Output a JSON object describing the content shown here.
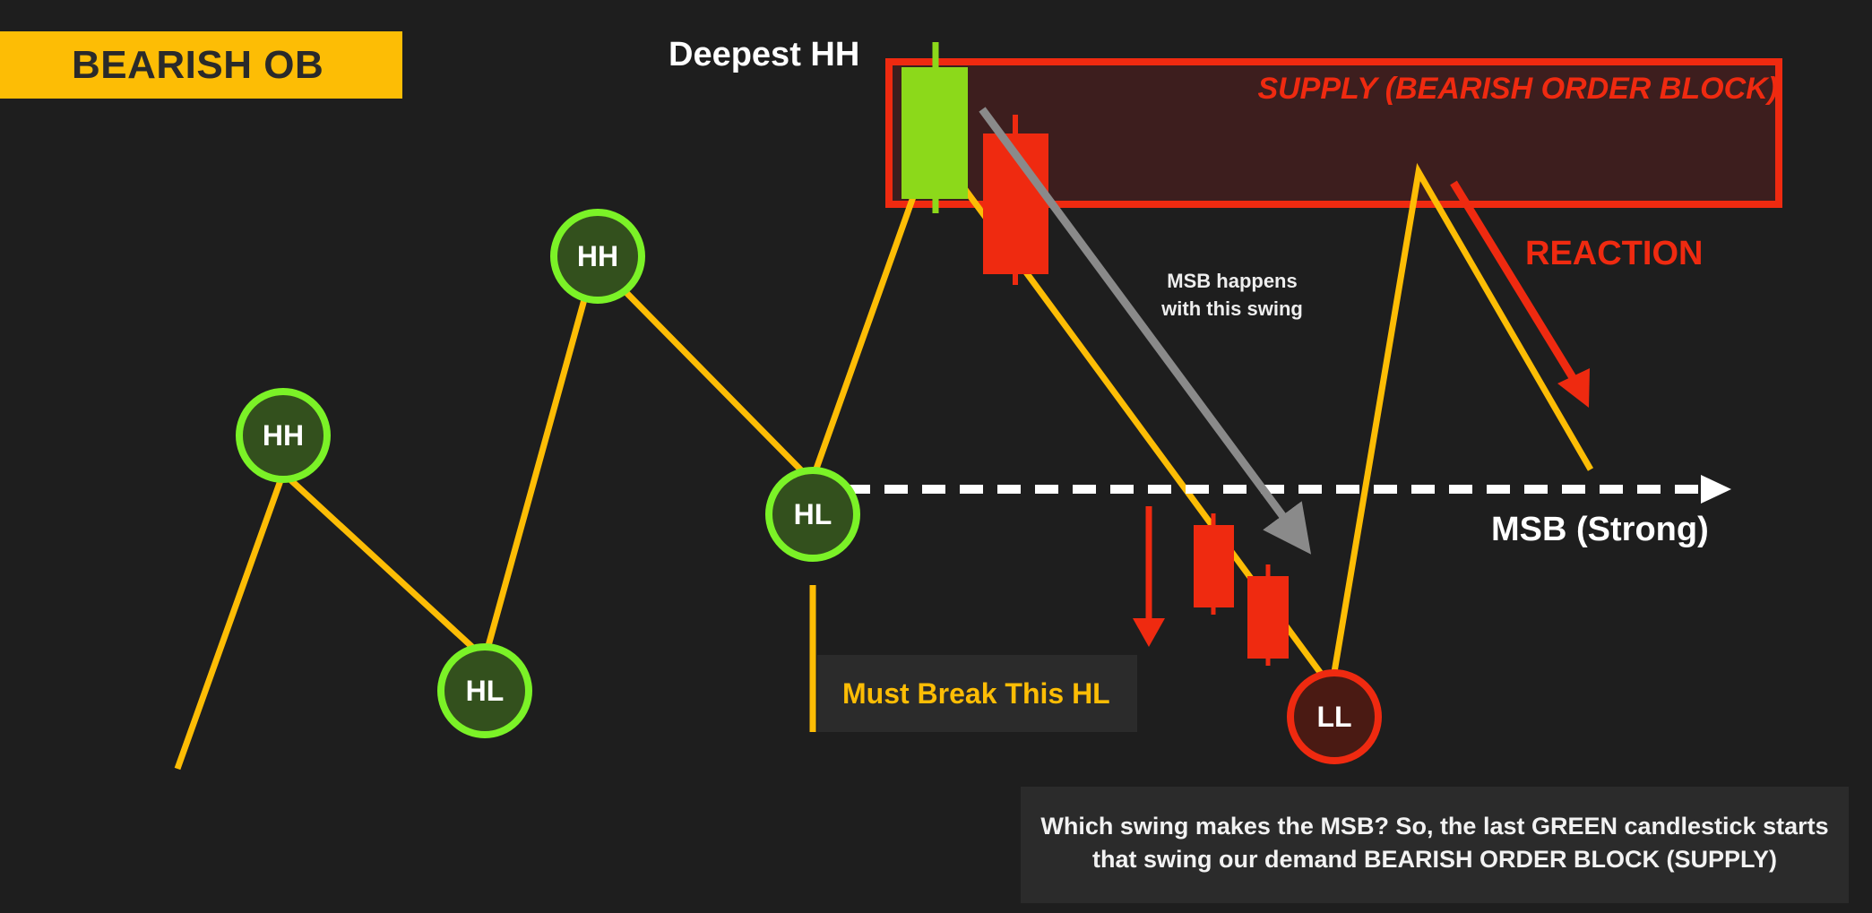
{
  "header": {
    "title": "BEARISH OB"
  },
  "labels": {
    "deepest_hh": "Deepest HH",
    "supply_zone": "SUPPLY  (BEARISH ORDER BLOCK)",
    "reaction": "REACTION",
    "msb_note": "MSB happens with this swing",
    "msb_strong": "MSB (Strong)",
    "must_break": "Must Break This HL",
    "footer_note": "Which swing makes the MSB? So, the last GREEN candlestick starts that swing our demand BEARISH ORDER BLOCK (SUPPLY)"
  },
  "nodes": [
    {
      "id": "hh1",
      "label": "HH",
      "kind": "high"
    },
    {
      "id": "hl1",
      "label": "HL",
      "kind": "low"
    },
    {
      "id": "hh2",
      "label": "HH",
      "kind": "high"
    },
    {
      "id": "hl2",
      "label": "HL",
      "kind": "low"
    },
    {
      "id": "ll1",
      "label": "LL",
      "kind": "lower-low"
    }
  ],
  "colors": {
    "background": "#1e1e1e",
    "price_path": "#fdbd05",
    "bull_node": "#7bf227",
    "bear": "#ef2a10",
    "bull_candle": "#8cd91a",
    "supply_fill": "#3d1e1e",
    "msb_line": "#ffffff",
    "msb_arrow": "#8a8a8a"
  },
  "icons": {
    "msb_arrowhead": "arrow-right-icon",
    "break_arrow": "arrow-down-icon",
    "reaction_arrow": "arrow-down-right-icon",
    "swing_arrow": "arrow-down-right-icon"
  }
}
